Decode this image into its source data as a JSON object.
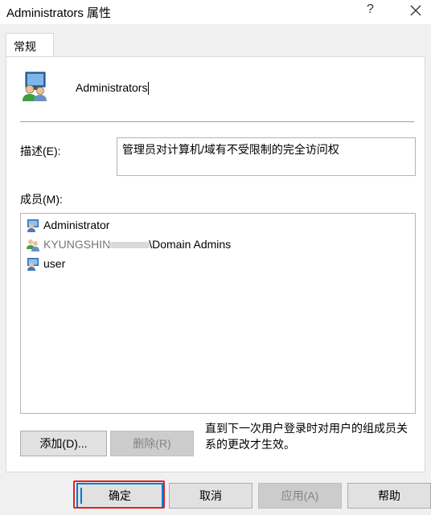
{
  "window": {
    "title": "Administrators 属性",
    "help_symbol": "?",
    "close_icon": "close-icon"
  },
  "tabs": [
    {
      "label": "常规"
    }
  ],
  "general": {
    "group_name": "Administrators",
    "description_label": "描述(E):",
    "description_value": "管理员对计算机/域有不受限制的完全访问权",
    "members_label": "成员(M):",
    "members": [
      {
        "icon": "user-icon",
        "name": "Administrator"
      },
      {
        "icon": "group-icon",
        "name_prefix": "KYUNGSHIN",
        "name": "\\Domain Admins",
        "redacted": true
      },
      {
        "icon": "user-icon",
        "name": "user"
      }
    ],
    "add_button": "添加(D)...",
    "remove_button": "删除(R)",
    "note": "直到下一次用户登录时对用户的组成员关系的更改才生效。"
  },
  "footer": {
    "ok": "确定",
    "cancel": "取消",
    "apply": "应用(A)",
    "help": "帮助"
  },
  "colors": {
    "accent": "#0078d7",
    "highlight_box": "#e0231f",
    "window_bg": "#f0f0f0"
  }
}
